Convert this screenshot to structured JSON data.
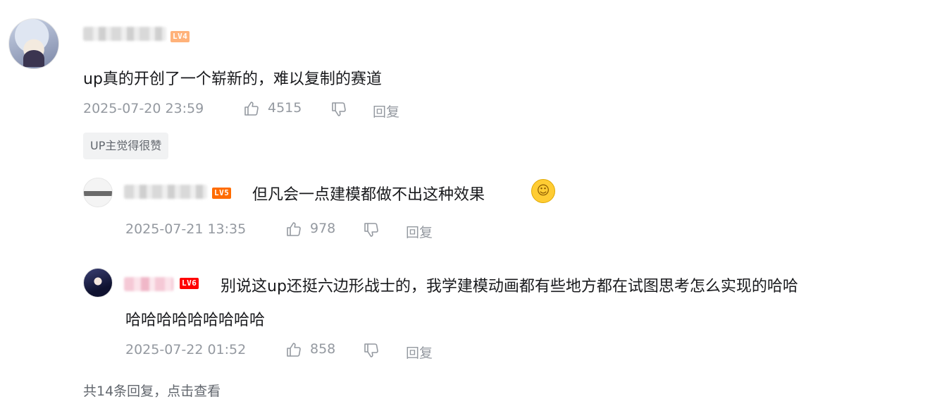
{
  "root_comment": {
    "level_badge": "LV4",
    "text": "up真的开创了一个崭新的，难以复制的赛道",
    "time": "2025-07-20 23:59",
    "likes": "4515",
    "reply_label": "回复",
    "up_tag": "UP主觉得很赞"
  },
  "replies": [
    {
      "level_badge": "LV5",
      "text": "但凡会一点建模都做不出这种效果",
      "emoji": "laughing-crying-emoji",
      "time": "2025-07-21 13:35",
      "likes": "978",
      "reply_label": "回复"
    },
    {
      "level_badge": "LV6",
      "text_line1": "别说这up还挺六边形战士的，我学建模动画都有些地方都在试图思考怎么实现的哈哈",
      "text_line2": "哈哈哈哈哈哈哈哈哈",
      "time": "2025-07-22 01:52",
      "likes": "858",
      "reply_label": "回复"
    }
  ],
  "footer": {
    "more_replies": "共14条回复，点击查看"
  },
  "colors": {
    "text_primary": "#18191c",
    "text_meta": "#9499a0",
    "tag_bg": "#f1f2f3",
    "lv4": "#ffb27a",
    "lv5": "#ff6c00",
    "lv6": "#ff0000"
  }
}
